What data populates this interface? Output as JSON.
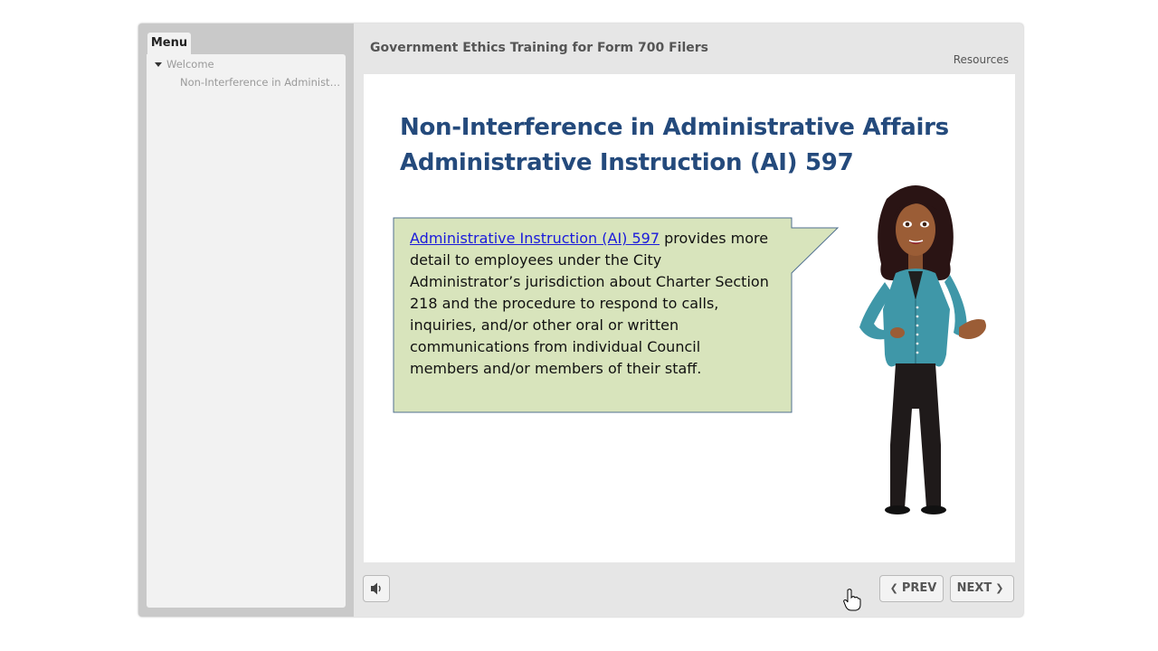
{
  "sidebar": {
    "menu_label": "Menu",
    "tree": [
      {
        "label": "Welcome"
      },
      {
        "label": "Non-Interference in Administrat..."
      }
    ]
  },
  "header": {
    "course_title": "Government Ethics Training for Form 700 Filers",
    "resources_label": "Resources"
  },
  "slide": {
    "heading_line1": "Non-Interference in Administrative Affairs",
    "heading_line2": "Administrative Instruction (AI) 597",
    "bubble": {
      "link_text": "Administrative Instruction (AI) 597",
      "body_text": " provides more detail to employees under the City Administrator’s jurisdiction about Charter Section 218  and the procedure to respond to calls, inquiries, and/or other oral or written communications from individual Council members and/or members of their staff."
    }
  },
  "controls": {
    "audio_icon": "speaker-icon",
    "prev_label": "PREV",
    "next_label": "NEXT"
  },
  "colors": {
    "heading": "#244a7c",
    "bubble_fill": "#d8e4bc",
    "link": "#1a1adb"
  }
}
